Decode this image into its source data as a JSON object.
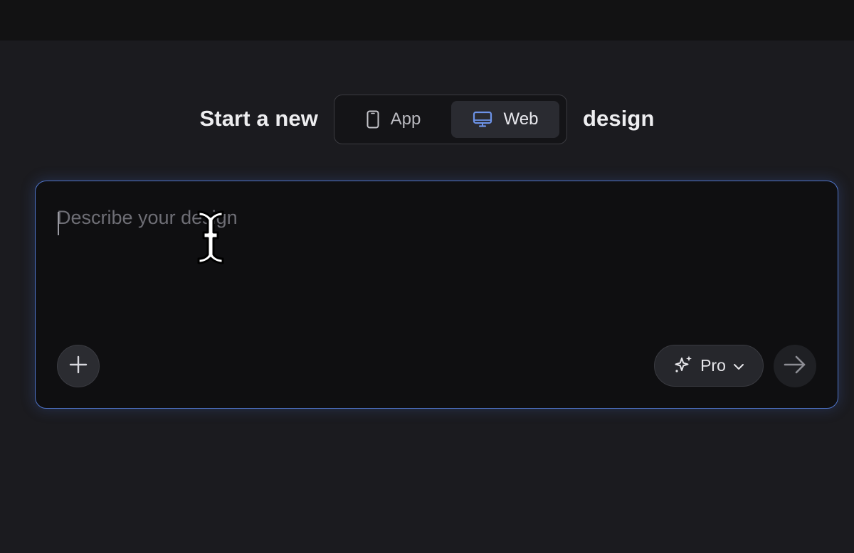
{
  "header": {
    "prefix": "Start a new",
    "suffix": "design"
  },
  "platform_toggle": {
    "options": [
      {
        "label": "App",
        "icon": "mobile-phone-icon",
        "selected": false
      },
      {
        "label": "Web",
        "icon": "monitor-icon",
        "selected": true
      }
    ]
  },
  "composer": {
    "placeholder": "Describe your design",
    "value": "",
    "add_icon": "plus-icon",
    "model": {
      "label": "Pro",
      "icon": "sparkles-icon",
      "dropdown_icon": "chevron-down-icon"
    },
    "send_icon": "arrow-right-icon"
  },
  "colors": {
    "accent_border": "#4f74c9",
    "web_icon": "#6d93e8",
    "background": "#1b1b1f",
    "composer_bg": "#0f0f11"
  }
}
